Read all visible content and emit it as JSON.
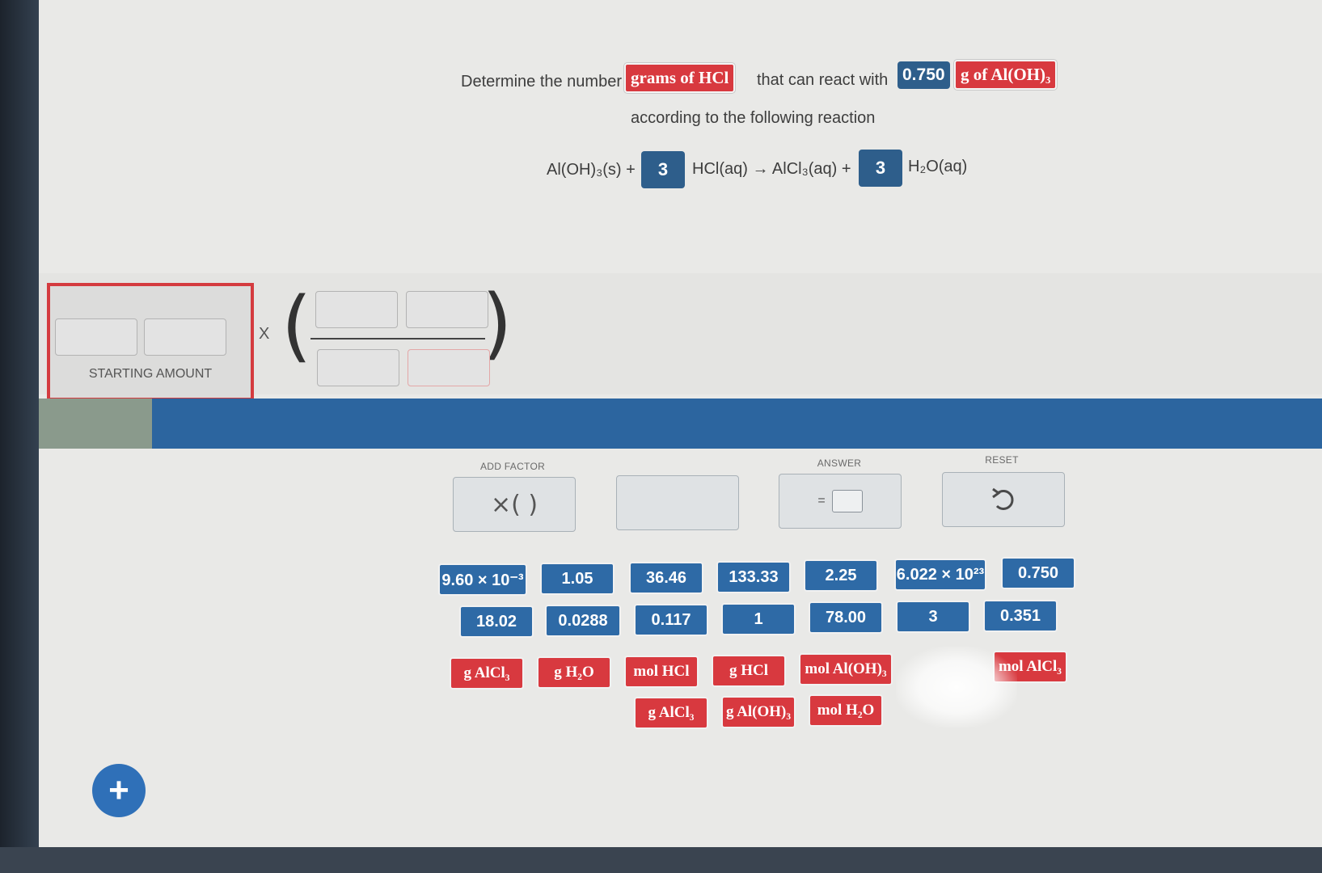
{
  "prompt": {
    "prefix": "Determine the number of",
    "target_unit": "grams of HCl",
    "middle": "that can react with",
    "given_value": "0.750",
    "given_unit": "g of Al(OH)₃",
    "line2": "according to the following reaction"
  },
  "reaction": {
    "reactant1": "Al(OH)₃(s) +",
    "coef1": "3",
    "middle": "HCl(aq) → AlCl₃(aq) +",
    "coef2": "3",
    "product2": "H₂O(aq)"
  },
  "workspace": {
    "starting_amount_label": "STARTING AMOUNT",
    "multiply_sign": "X"
  },
  "controls": {
    "add_factor_label": "ADD FACTOR",
    "add_factor_symbol": "×(  )",
    "answer_label": "ANSWER",
    "answer_symbol": "=",
    "reset_label": "RESET",
    "reset_icon": "undo-icon"
  },
  "number_tiles_row1": [
    "9.60 × 10⁻³",
    "1.05",
    "36.46",
    "133.33",
    "2.25",
    "6.022 × 10²³",
    "0.750"
  ],
  "number_tiles_row2": [
    "18.02",
    "0.0288",
    "0.117",
    "1",
    "78.00",
    "3",
    "0.351"
  ],
  "unit_tiles_row1": [
    "g AlCl₃",
    "g H₂O",
    "mol HCl",
    "g HCl",
    "mol Al(OH)₃",
    "mol AlCl₃"
  ],
  "unit_tiles_row2": [
    "g AlCl₃",
    "g Al(OH)₃",
    "mol H₂O"
  ],
  "add_button": "+",
  "colors": {
    "red": "#d8393f",
    "blue": "#2e6aa6",
    "band": "#2c659f"
  }
}
